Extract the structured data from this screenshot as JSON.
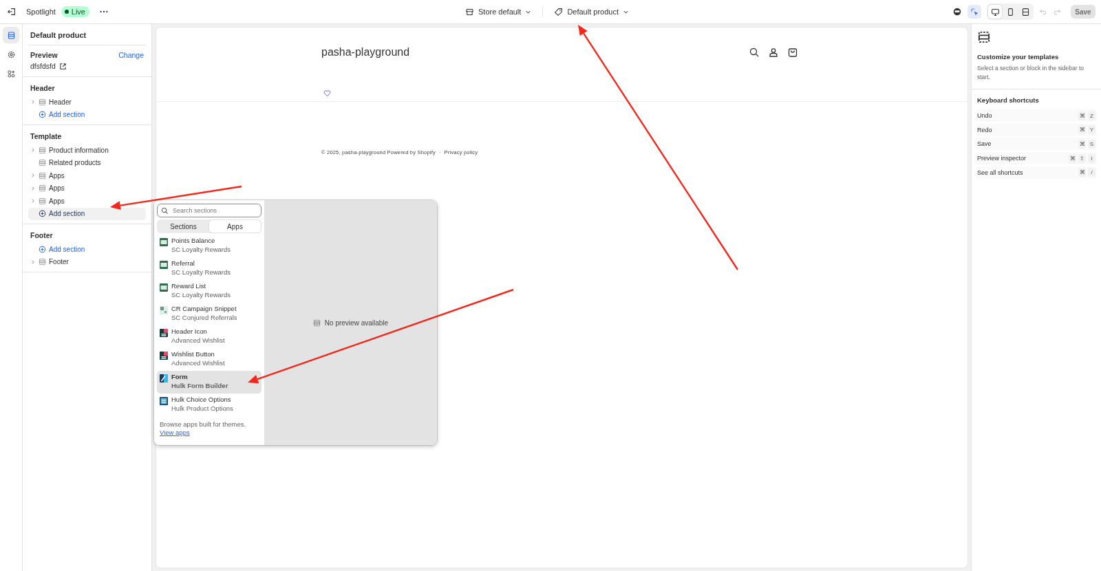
{
  "topbar": {
    "app_name": "Spotlight",
    "status": "Live",
    "store_selector": "Store default",
    "template_selector": "Default product",
    "view_tools": [
      {
        "kind": "inspector",
        "selected": true
      }
    ],
    "device_tools": [
      {
        "kind": "desktop",
        "selected": true
      },
      {
        "kind": "mobile",
        "selected": false
      },
      {
        "kind": "fullwidth",
        "selected": false
      }
    ],
    "save_button": {
      "label": "Save",
      "disabled": true
    }
  },
  "rail": [
    {
      "kind": "sections",
      "selected": true
    },
    {
      "kind": "settings",
      "selected": false
    },
    {
      "kind": "apps",
      "selected": false
    }
  ],
  "sidebar": {
    "title": "Default product",
    "preview": {
      "label": "Preview",
      "action": "Change",
      "value": "dfsfdsfd"
    },
    "groups": [
      {
        "title": "Header",
        "entries": [
          {
            "kind": "section",
            "label": "Header",
            "expandable": true
          },
          {
            "kind": "add",
            "label": "Add section",
            "highlighted": false
          }
        ]
      },
      {
        "title": "Template",
        "entries": [
          {
            "kind": "section",
            "label": "Product information",
            "expandable": true
          },
          {
            "kind": "section",
            "label": "Related products",
            "expandable": false
          },
          {
            "kind": "section",
            "label": "Apps",
            "expandable": true
          },
          {
            "kind": "section",
            "label": "Apps",
            "expandable": true
          },
          {
            "kind": "section",
            "label": "Apps",
            "expandable": true
          },
          {
            "kind": "add",
            "label": "Add section",
            "highlighted": true
          }
        ]
      },
      {
        "title": "Footer",
        "entries": [
          {
            "kind": "add",
            "label": "Add section",
            "highlighted": false
          },
          {
            "kind": "section",
            "label": "Footer",
            "expandable": true
          }
        ]
      }
    ]
  },
  "store_preview": {
    "shop_name": "pasha-playground",
    "copyright": "© 2025, pasha-playground Powered by Shopify",
    "separator": "·",
    "policy_link": "Privacy policy"
  },
  "popup": {
    "search": {
      "placeholder": "Search sections"
    },
    "tabs": [
      {
        "label": "Sections",
        "selected": false
      },
      {
        "label": "Apps",
        "selected": true
      }
    ],
    "items": [
      {
        "title": "Points Balance",
        "app": "SC Loyalty Rewards",
        "kind": "loyalty",
        "selected": false
      },
      {
        "title": "Referral",
        "app": "SC Loyalty Rewards",
        "kind": "loyalty",
        "selected": false
      },
      {
        "title": "Reward List",
        "app": "SC Loyalty Rewards",
        "kind": "loyalty",
        "selected": false
      },
      {
        "title": "CR Campaign Snippet",
        "app": "SC Conjured Referrals",
        "kind": "campaign",
        "selected": false
      },
      {
        "title": "Header Icon",
        "app": "Advanced Wishlist",
        "kind": "wishlist",
        "selected": false
      },
      {
        "title": "Wishlist Button",
        "app": "Advanced Wishlist",
        "kind": "wishlist",
        "selected": false
      },
      {
        "title": "Form",
        "app": "Hulk Form Builder",
        "kind": "form",
        "selected": true
      },
      {
        "title": "Hulk Choice Options",
        "app": "Hulk Product Options",
        "kind": "choice",
        "selected": false
      }
    ],
    "footer": {
      "text": "Browse apps built for themes.",
      "link": "View apps"
    },
    "preview_message": "No preview available"
  },
  "right_panel": {
    "title": "Customize your templates",
    "description": "Select a section or block in the sidebar to start.",
    "shortcuts_title": "Keyboard shortcuts",
    "shortcuts": [
      {
        "label": "Undo",
        "keys": [
          "⌘",
          "Z"
        ]
      },
      {
        "label": "Redo",
        "keys": [
          "⌘",
          "Y"
        ]
      },
      {
        "label": "Save",
        "keys": [
          "⌘",
          "S"
        ]
      },
      {
        "label": "Preview inspector",
        "keys": [
          "⌘",
          "⇧",
          "I"
        ]
      },
      {
        "label": "See all shortcuts",
        "keys": [
          "⌘",
          "/"
        ]
      }
    ]
  }
}
